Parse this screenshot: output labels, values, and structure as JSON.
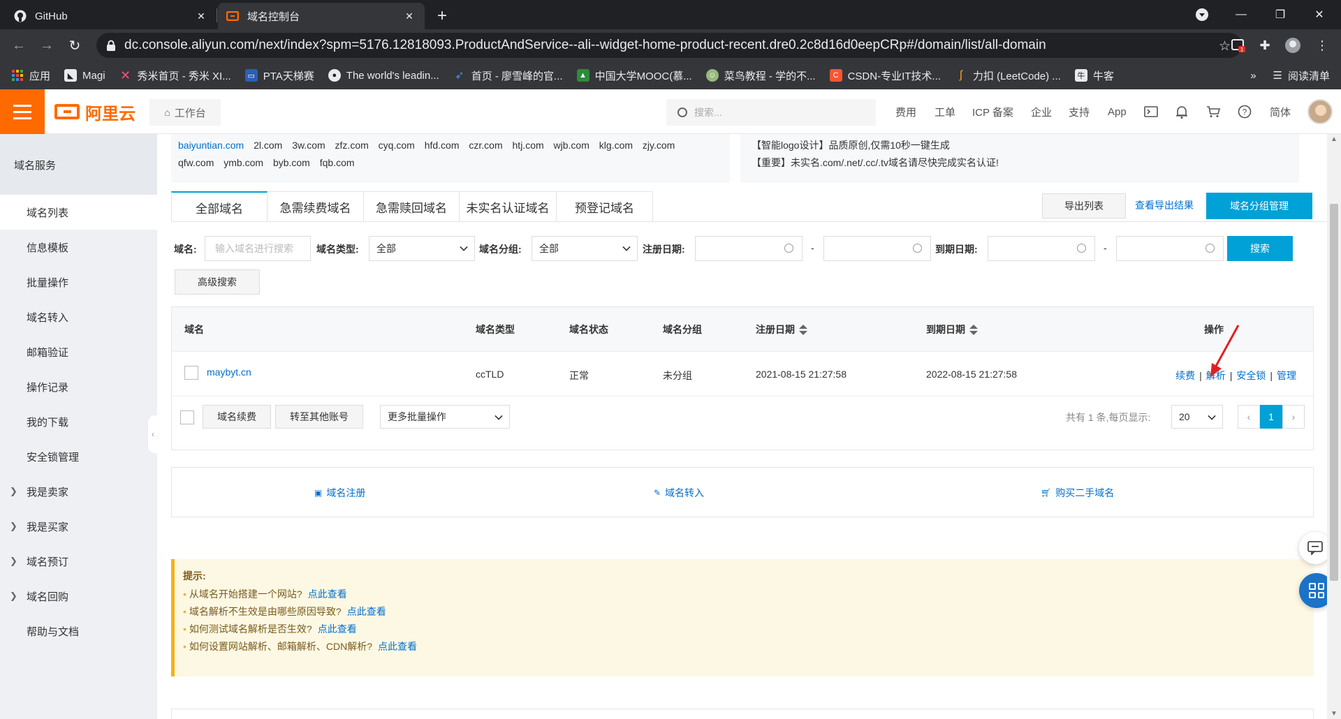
{
  "browser": {
    "tabs": [
      {
        "title": "GitHub",
        "icon": "github-icon"
      },
      {
        "title": "域名控制台",
        "icon": "aliyun-icon"
      }
    ],
    "url": "dc.console.aliyun.com/next/index?spm=5176.12818093.ProductAndService--ali--widget-home-product-recent.dre0.2c8d16d0eepCRp#/domain/list/all-domain",
    "extension_badge": "1",
    "bookmarks": [
      {
        "label": "应用",
        "icon": "apps-grid-icon"
      },
      {
        "label": "Magi",
        "icon": "magi-icon"
      },
      {
        "label": "秀米首页 - 秀米 XI...",
        "icon": "xiumi-icon"
      },
      {
        "label": "PTA天梯赛",
        "icon": "pta-icon"
      },
      {
        "label": "The world's leadin...",
        "icon": "github-icon"
      },
      {
        "label": "首页 - 廖雪峰的官...",
        "icon": "rocket-icon"
      },
      {
        "label": "中国大学MOOC(慕...",
        "icon": "mooc-icon"
      },
      {
        "label": "菜鸟教程 - 学的不...",
        "icon": "runoob-icon"
      },
      {
        "label": "CSDN-专业IT技术...",
        "icon": "csdn-icon"
      },
      {
        "label": "力扣 (LeetCode) ...",
        "icon": "leetcode-icon"
      },
      {
        "label": "牛客",
        "icon": "nowcoder-icon"
      }
    ],
    "more_label": "»",
    "reading_list": "阅读清单"
  },
  "header": {
    "logo_text": "阿里云",
    "workbench": "工作台",
    "search_placeholder": "搜索...",
    "nav": [
      "费用",
      "工单",
      "ICP 备案",
      "企业",
      "支持",
      "App"
    ],
    "lang": "简体"
  },
  "sidebar": {
    "title": "域名服务",
    "items": [
      {
        "label": "域名列表",
        "active": true
      },
      {
        "label": "信息模板"
      },
      {
        "label": "批量操作"
      },
      {
        "label": "域名转入"
      },
      {
        "label": "邮箱验证"
      },
      {
        "label": "操作记录"
      },
      {
        "label": "我的下载"
      },
      {
        "label": "安全锁管理"
      },
      {
        "label": "我是卖家",
        "expandable": true
      },
      {
        "label": "我是买家",
        "expandable": true
      },
      {
        "label": "域名预订",
        "expandable": true
      },
      {
        "label": "域名回购",
        "expandable": true
      },
      {
        "label": "帮助与文档"
      }
    ]
  },
  "promo": {
    "domains_line1": [
      "baiyuntian.com",
      "2l.com",
      "3w.com",
      "zfz.com",
      "cyq.com",
      "hfd.com",
      "czr.com",
      "htj.com",
      "wjb.com",
      "klg.com",
      "zjy.com"
    ],
    "domains_line2": [
      "qfw.com",
      "ymb.com",
      "byb.com",
      "fqb.com"
    ],
    "notice1": "【智能logo设计】品质原创,仅需10秒一键生成",
    "notice2": "【重要】未实名.com/.net/.cc/.tv域名请尽快完成实名认证!"
  },
  "tabs": [
    "全部域名",
    "急需续费域名",
    "急需赎回域名",
    "未实名认证域名",
    "预登记域名"
  ],
  "actions": {
    "export": "导出列表",
    "view_export": "查看导出结果",
    "group_manage": "域名分组管理"
  },
  "filters": {
    "domain_label": "域名:",
    "domain_placeholder": "输入域名进行搜索",
    "type_label": "域名类型:",
    "type_value": "全部",
    "group_label": "域名分组:",
    "group_value": "全部",
    "reg_date_label": "注册日期:",
    "exp_date_label": "到期日期:",
    "range_sep": "-",
    "search": "搜索",
    "advanced": "高级搜索"
  },
  "table": {
    "columns": [
      "域名",
      "域名类型",
      "域名状态",
      "域名分组",
      "注册日期",
      "到期日期",
      "操作"
    ],
    "rows": [
      {
        "domain": "maybyt.cn",
        "type": "ccTLD",
        "status": "正常",
        "group": "未分组",
        "reg_date": "2021-08-15 21:27:58",
        "exp_date": "2022-08-15 21:27:58"
      }
    ],
    "row_ops": [
      "续费",
      "解析",
      "安全锁",
      "管理"
    ],
    "op_sep": "|",
    "bulk_renew": "域名续费",
    "bulk_transfer": "转至其他账号",
    "bulk_more": "更多批量操作",
    "total_text": "共有 1 条,每页显示:",
    "page_size": "20",
    "current_page": "1",
    "prev": "‹",
    "next": "›"
  },
  "quick_links": [
    {
      "label": "域名注册",
      "icon": "register-icon"
    },
    {
      "label": "域名转入",
      "icon": "link-icon"
    },
    {
      "label": "购买二手域名",
      "icon": "cart-icon"
    }
  ],
  "tips": {
    "title": "提示:",
    "items": [
      {
        "text": "从域名开始搭建一个网站?",
        "link": "点此查看"
      },
      {
        "text": "域名解析不生效是由哪些原因导致?",
        "link": "点此查看"
      },
      {
        "text": "如何测试域名解析是否生效?",
        "link": "点此查看"
      },
      {
        "text": "如何设置网站解析、邮箱解析、CDN解析?",
        "link": "点此查看"
      }
    ]
  },
  "colors": {
    "brand": "#ff6a00",
    "primary": "#00a1d6",
    "link": "#0070cc",
    "annotation": "#e02020"
  }
}
